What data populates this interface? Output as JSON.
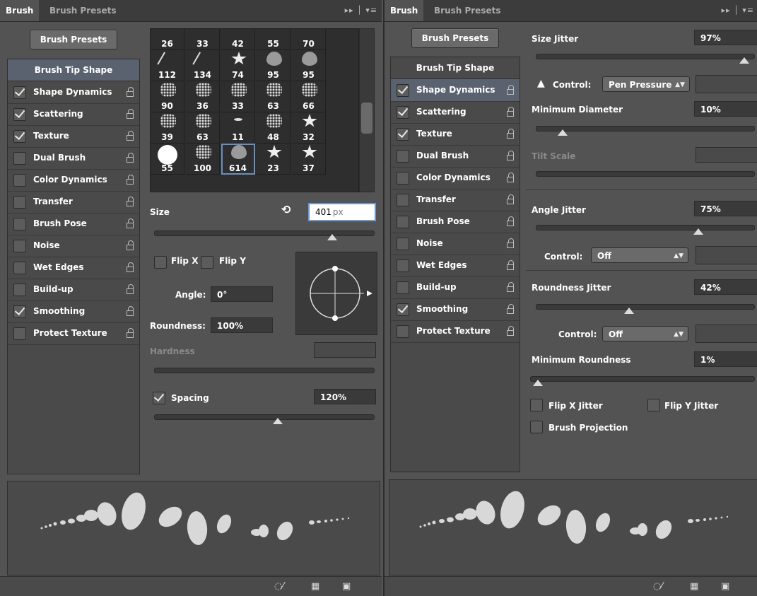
{
  "left": {
    "tabs": [
      "Brush",
      "Brush Presets"
    ],
    "tab_controls": "▸▸ │ ▾≡",
    "presets_button": "Brush Presets",
    "tip_shape": "Brush Tip Shape",
    "options": [
      {
        "label": "Shape Dynamics",
        "checked": true
      },
      {
        "label": "Scattering",
        "checked": true
      },
      {
        "label": "Texture",
        "checked": true
      },
      {
        "label": "Dual Brush",
        "checked": false
      },
      {
        "label": "Color Dynamics",
        "checked": false
      },
      {
        "label": "Transfer",
        "checked": false
      },
      {
        "label": "Brush Pose",
        "checked": false
      },
      {
        "label": "Noise",
        "checked": false
      },
      {
        "label": "Wet Edges",
        "checked": false
      },
      {
        "label": "Build-up",
        "checked": false
      },
      {
        "label": "Smoothing",
        "checked": true
      },
      {
        "label": "Protect Texture",
        "checked": false
      }
    ],
    "brush_grid": {
      "rows": [
        [
          {
            "num": "26",
            "shape": "none"
          },
          {
            "num": "33",
            "shape": "none"
          },
          {
            "num": "42",
            "shape": "none"
          },
          {
            "num": "55",
            "shape": "none"
          },
          {
            "num": "70",
            "shape": "none"
          }
        ],
        [
          {
            "num": "112",
            "shape": "line"
          },
          {
            "num": "134",
            "shape": "line"
          },
          {
            "num": "74",
            "shape": "star"
          },
          {
            "num": "95",
            "shape": "leaf"
          },
          {
            "num": "95",
            "shape": "leaf"
          }
        ],
        [
          {
            "num": "90",
            "shape": "spatter"
          },
          {
            "num": "36",
            "shape": "spatter"
          },
          {
            "num": "33",
            "shape": "spatter"
          },
          {
            "num": "63",
            "shape": "spatter"
          },
          {
            "num": "66",
            "shape": "spatter"
          }
        ],
        [
          {
            "num": "39",
            "shape": "spatter"
          },
          {
            "num": "63",
            "shape": "spatter"
          },
          {
            "num": "11",
            "shape": "dot"
          },
          {
            "num": "48",
            "shape": "spatter"
          },
          {
            "num": "32",
            "shape": "star"
          }
        ],
        [
          {
            "num": "55",
            "shape": "round"
          },
          {
            "num": "100",
            "shape": "spatter"
          },
          {
            "num": "614",
            "shape": "leaf",
            "selected": true
          },
          {
            "num": "23",
            "shape": "star"
          },
          {
            "num": "37",
            "shape": "star"
          }
        ]
      ]
    },
    "size_label": "Size",
    "size_value": "401",
    "size_unit": "px",
    "flipx_label": "Flip X",
    "flipy_label": "Flip Y",
    "angle_label": "Angle:",
    "angle_value": "0°",
    "roundness_label": "Roundness:",
    "roundness_value": "100%",
    "hardness_label": "Hardness",
    "spacing_label": "Spacing",
    "spacing_value": "120%",
    "spacing_checked": true,
    "size_slider": 0.82,
    "spacing_slider": 0.56
  },
  "right": {
    "tabs": [
      "Brush",
      "Brush Presets"
    ],
    "tab_controls": "▸▸ │ ▾≡",
    "presets_button": "Brush Presets",
    "tip_shape": "Brush Tip Shape",
    "options": [
      {
        "label": "Shape Dynamics",
        "checked": true,
        "selected": true
      },
      {
        "label": "Scattering",
        "checked": true
      },
      {
        "label": "Texture",
        "checked": true
      },
      {
        "label": "Dual Brush",
        "checked": false
      },
      {
        "label": "Color Dynamics",
        "checked": false
      },
      {
        "label": "Transfer",
        "checked": false
      },
      {
        "label": "Brush Pose",
        "checked": false
      },
      {
        "label": "Noise",
        "checked": false
      },
      {
        "label": "Wet Edges",
        "checked": false
      },
      {
        "label": "Build-up",
        "checked": false
      },
      {
        "label": "Smoothing",
        "checked": true
      },
      {
        "label": "Protect Texture",
        "checked": false
      }
    ],
    "size_jitter_label": "Size Jitter",
    "size_jitter_value": "97%",
    "size_jitter_slider": 0.97,
    "control1_label": "Control:",
    "control1_value": "Pen Pressure",
    "min_diameter_label": "Minimum Diameter",
    "min_diameter_value": "10%",
    "min_diameter_slider": 0.1,
    "tilt_scale_label": "Tilt Scale",
    "angle_jitter_label": "Angle Jitter",
    "angle_jitter_value": "75%",
    "angle_jitter_slider": 0.75,
    "control2_label": "Control:",
    "control2_value": "Off",
    "roundness_jitter_label": "Roundness Jitter",
    "roundness_jitter_value": "42%",
    "roundness_jitter_slider": 0.42,
    "control3_label": "Control:",
    "control3_value": "Off",
    "min_roundness_label": "Minimum Roundness",
    "min_roundness_value": "1%",
    "min_roundness_slider": 0.01,
    "flipx_jitter_label": "Flip X Jitter",
    "flipy_jitter_label": "Flip Y Jitter",
    "brush_projection_label": "Brush Projection"
  }
}
